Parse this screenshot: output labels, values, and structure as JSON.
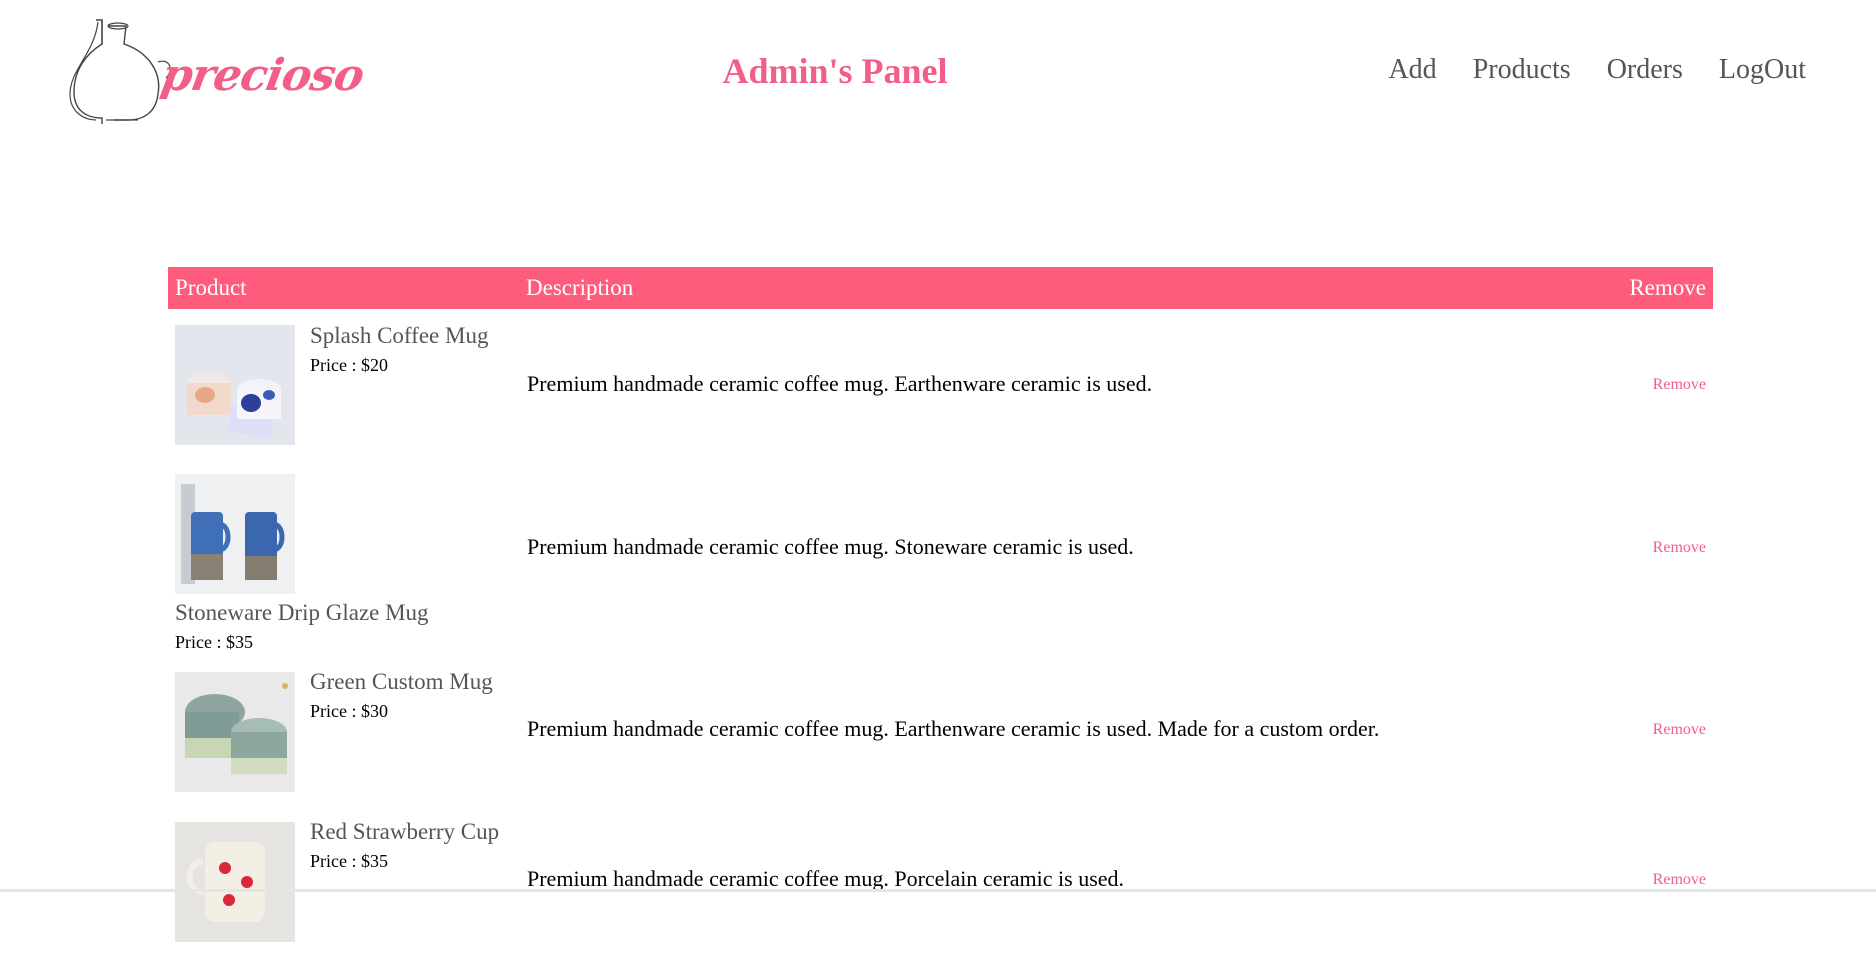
{
  "brand": {
    "logo_text": "precioso",
    "accent_color": "#f25e86",
    "header_bg": "#ff5c7d"
  },
  "header": {
    "title": "Admin's Panel"
  },
  "nav": {
    "items": [
      "Add",
      "Products",
      "Orders",
      "LogOut"
    ]
  },
  "table": {
    "columns": {
      "product": "Product",
      "description": "Description",
      "remove": "Remove"
    },
    "rows": [
      {
        "name": "Splash Coffee Mug",
        "price": "Price : $20",
        "description": "Premium handmade ceramic coffee mug. Earthenware ceramic is used.",
        "remove": "Remove",
        "image_icon": "mug-photo"
      },
      {
        "name": "Stoneware Drip Glaze Mug",
        "price": "Price : $35",
        "description": "Premium handmade ceramic coffee mug. Stoneware ceramic is used.",
        "remove": "Remove",
        "image_icon": "mug-photo"
      },
      {
        "name": "Green Custom Mug",
        "price": "Price : $30",
        "description": "Premium handmade ceramic coffee mug. Earthenware ceramic is used. Made for a custom order.",
        "remove": "Remove",
        "image_icon": "mug-photo"
      },
      {
        "name": "Red Strawberry Cup",
        "price": "Price : $35",
        "description": "Premium handmade ceramic coffee mug. Porcelain ceramic is used.",
        "remove": "Remove",
        "image_icon": "mug-photo"
      }
    ]
  }
}
